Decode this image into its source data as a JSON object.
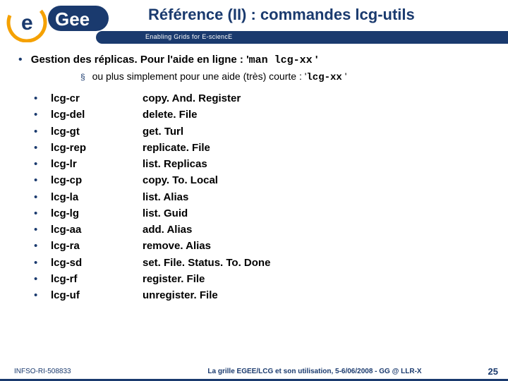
{
  "header": {
    "title": "Référence (II) : commandes lcg-utils",
    "subtitle": "Enabling Grids for E-sciencE",
    "logo_text_e": "e",
    "logo_text_gee": "Gee"
  },
  "intro": {
    "line1_prefix": "Gestion des réplicas. Pour l'aide en ligne : '",
    "line1_code": "man lcg-xx",
    "line1_suffix": " '",
    "line2_prefix": "ou plus simplement pour une aide (très) courte : '",
    "line2_code": "lcg-xx",
    "line2_suffix": " '"
  },
  "commands": [
    {
      "cmd": "lcg-cr",
      "desc": "copy. And. Register"
    },
    {
      "cmd": "lcg-del",
      "desc": "delete. File"
    },
    {
      "cmd": "lcg-gt",
      "desc": "get. Turl"
    },
    {
      "cmd": "lcg-rep",
      "desc": "replicate. File"
    },
    {
      "cmd": "lcg-lr",
      "desc": "list. Replicas"
    },
    {
      "cmd": "lcg-cp",
      "desc": "copy. To. Local"
    },
    {
      "cmd": "lcg-la",
      "desc": "list. Alias"
    },
    {
      "cmd": "lcg-lg",
      "desc": "list. Guid"
    },
    {
      "cmd": "lcg-aa",
      "desc": "add. Alias"
    },
    {
      "cmd": "lcg-ra",
      "desc": "remove. Alias"
    },
    {
      "cmd": "lcg-sd",
      "desc": "set. File. Status. To. Done"
    },
    {
      "cmd": "lcg-rf",
      "desc": "register. File"
    },
    {
      "cmd": "lcg-uf",
      "desc": "unregister. File"
    }
  ],
  "footer": {
    "left": "INFSO-RI-508833",
    "center": "La grille EGEE/LCG et son utilisation, 5-6/06/2008 - GG @ LLR-X",
    "right": "25"
  }
}
